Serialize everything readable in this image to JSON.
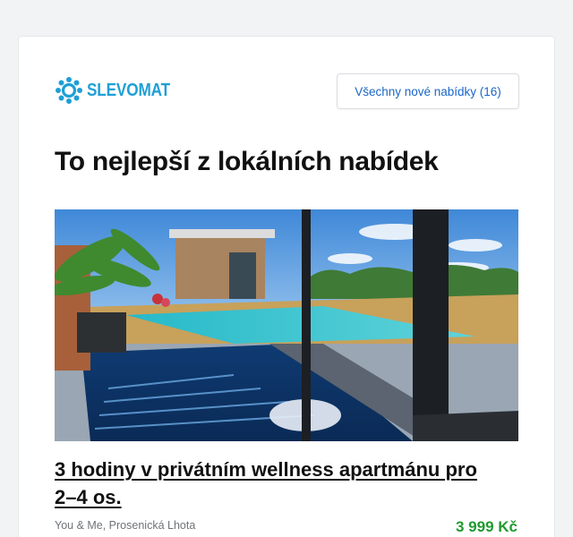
{
  "header": {
    "logo_text": "SLEVOMAT",
    "logo_icon": "gear-icon",
    "all_offers_label": "Všechny nové nabídky (16)"
  },
  "main": {
    "headline": "To nejlepší z lokálních nabídek",
    "offer": {
      "image_alt": "wellness-apartment-pool-photo",
      "title": "3 hodiny v privátním wellness apartmánu pro 2–4 os.",
      "vendor": "You & Me, Prosenická Lhota",
      "price": "3 999 Kč"
    }
  },
  "colors": {
    "brand": "#1f9fd6",
    "link": "#1a66c7",
    "price": "#1e9a2f"
  }
}
